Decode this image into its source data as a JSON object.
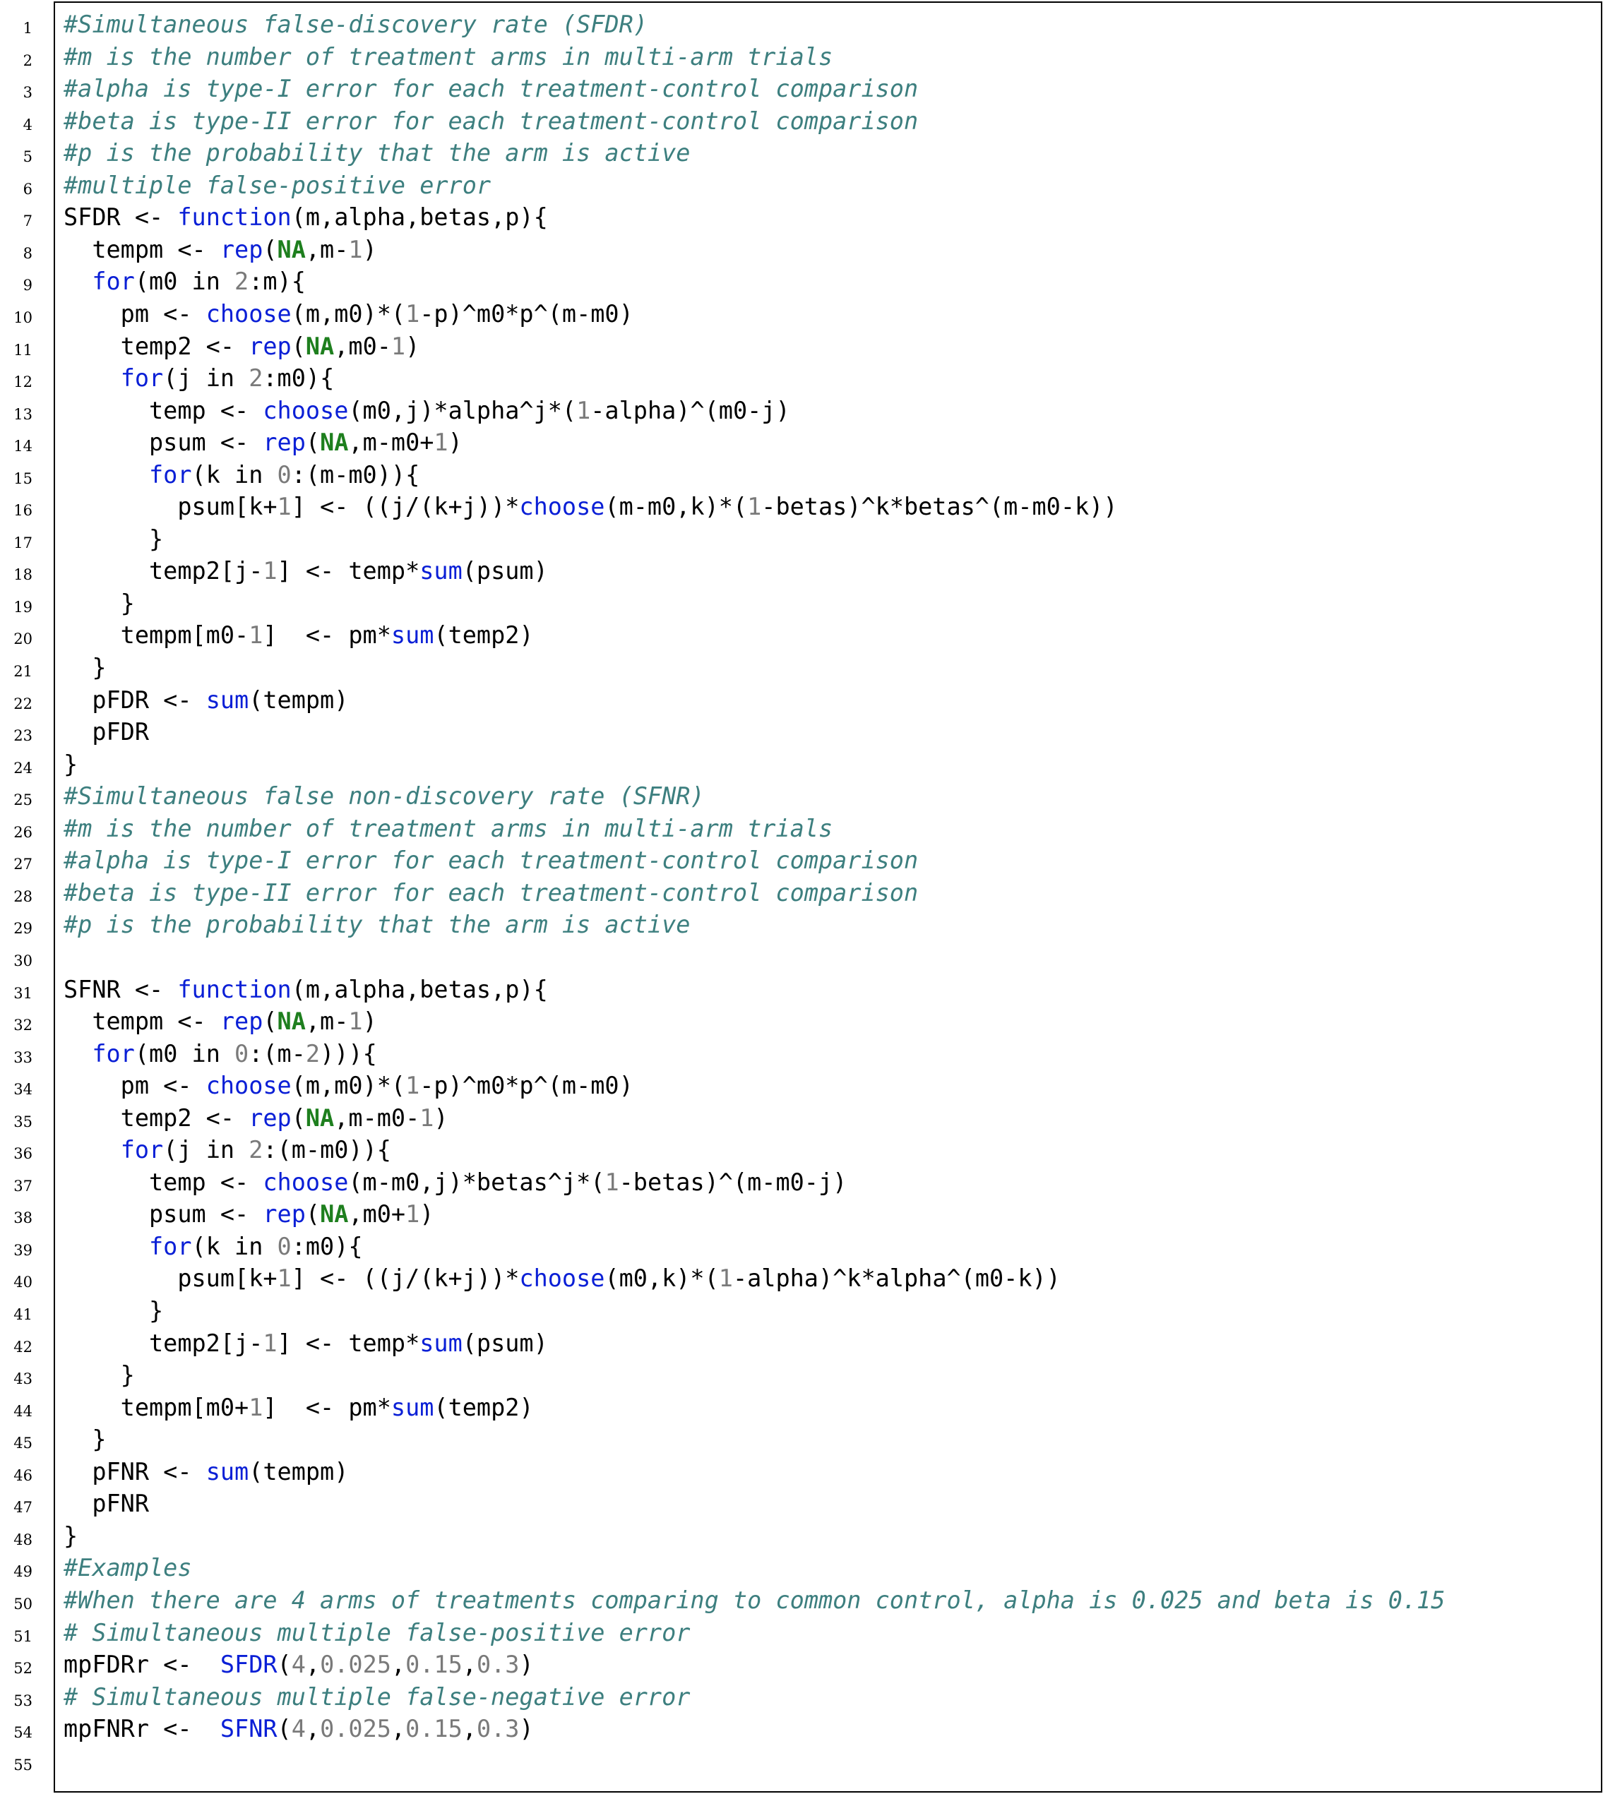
{
  "listing": {
    "lines": [
      {
        "num": "1",
        "tokens": [
          [
            "c",
            "#Simultaneous false-discovery rate (SFDR)"
          ]
        ]
      },
      {
        "num": "2",
        "tokens": [
          [
            "c",
            "#m is the number of treatment arms in multi-arm trials"
          ]
        ]
      },
      {
        "num": "3",
        "tokens": [
          [
            "c",
            "#alpha is type-I error for each treatment-control comparison"
          ]
        ]
      },
      {
        "num": "4",
        "tokens": [
          [
            "c",
            "#beta is type-II error for each treatment-control comparison"
          ]
        ]
      },
      {
        "num": "5",
        "tokens": [
          [
            "c",
            "#p is the probability that the arm is active"
          ]
        ]
      },
      {
        "num": "6",
        "tokens": [
          [
            "c",
            "#multiple false-positive error"
          ]
        ]
      },
      {
        "num": "7",
        "tokens": [
          [
            "t",
            "SFDR <- "
          ],
          [
            "k",
            "function"
          ],
          [
            "t",
            "(m,alpha,betas,p){"
          ]
        ]
      },
      {
        "num": "8",
        "tokens": [
          [
            "t",
            "  tempm <- "
          ],
          [
            "k",
            "rep"
          ],
          [
            "t",
            "("
          ],
          [
            "g",
            "NA"
          ],
          [
            "t",
            ",m-"
          ],
          [
            "n",
            "1"
          ],
          [
            "t",
            ")"
          ]
        ]
      },
      {
        "num": "9",
        "tokens": [
          [
            "t",
            "  "
          ],
          [
            "k",
            "for"
          ],
          [
            "t",
            "(m0 in "
          ],
          [
            "n",
            "2"
          ],
          [
            "t",
            ":m){"
          ]
        ]
      },
      {
        "num": "10",
        "tokens": [
          [
            "t",
            "    pm <- "
          ],
          [
            "k",
            "choose"
          ],
          [
            "t",
            "(m,m0)*("
          ],
          [
            "n",
            "1"
          ],
          [
            "t",
            "-p)^m0*p^(m-m0)"
          ]
        ]
      },
      {
        "num": "11",
        "tokens": [
          [
            "t",
            "    temp2 <- "
          ],
          [
            "k",
            "rep"
          ],
          [
            "t",
            "("
          ],
          [
            "g",
            "NA"
          ],
          [
            "t",
            ",m0-"
          ],
          [
            "n",
            "1"
          ],
          [
            "t",
            ")"
          ]
        ]
      },
      {
        "num": "12",
        "tokens": [
          [
            "t",
            "    "
          ],
          [
            "k",
            "for"
          ],
          [
            "t",
            "(j in "
          ],
          [
            "n",
            "2"
          ],
          [
            "t",
            ":m0){"
          ]
        ]
      },
      {
        "num": "13",
        "tokens": [
          [
            "t",
            "      temp <- "
          ],
          [
            "k",
            "choose"
          ],
          [
            "t",
            "(m0,j)*alpha^j*("
          ],
          [
            "n",
            "1"
          ],
          [
            "t",
            "-alpha)^(m0-j)"
          ]
        ]
      },
      {
        "num": "14",
        "tokens": [
          [
            "t",
            "      psum <- "
          ],
          [
            "k",
            "rep"
          ],
          [
            "t",
            "("
          ],
          [
            "g",
            "NA"
          ],
          [
            "t",
            ",m-m0+"
          ],
          [
            "n",
            "1"
          ],
          [
            "t",
            ")"
          ]
        ]
      },
      {
        "num": "15",
        "tokens": [
          [
            "t",
            "      "
          ],
          [
            "k",
            "for"
          ],
          [
            "t",
            "(k in "
          ],
          [
            "n",
            "0"
          ],
          [
            "t",
            ":(m-m0)){"
          ]
        ]
      },
      {
        "num": "16",
        "tokens": [
          [
            "t",
            "        psum[k+"
          ],
          [
            "n",
            "1"
          ],
          [
            "t",
            "] <- ((j/(k+j))*"
          ],
          [
            "k",
            "choose"
          ],
          [
            "t",
            "(m-m0,k)*("
          ],
          [
            "n",
            "1"
          ],
          [
            "t",
            "-betas)^k*betas^(m-m0-k))"
          ]
        ]
      },
      {
        "num": "17",
        "tokens": [
          [
            "t",
            "      }"
          ]
        ]
      },
      {
        "num": "18",
        "tokens": [
          [
            "t",
            "      temp2[j-"
          ],
          [
            "n",
            "1"
          ],
          [
            "t",
            "] <- temp*"
          ],
          [
            "k",
            "sum"
          ],
          [
            "t",
            "(psum)"
          ]
        ]
      },
      {
        "num": "19",
        "tokens": [
          [
            "t",
            "    }"
          ]
        ]
      },
      {
        "num": "20",
        "tokens": [
          [
            "t",
            "    tempm[m0-"
          ],
          [
            "n",
            "1"
          ],
          [
            "t",
            "]  <- pm*"
          ],
          [
            "k",
            "sum"
          ],
          [
            "t",
            "(temp2)"
          ]
        ]
      },
      {
        "num": "21",
        "tokens": [
          [
            "t",
            "  }"
          ]
        ]
      },
      {
        "num": "22",
        "tokens": [
          [
            "t",
            "  pFDR <- "
          ],
          [
            "k",
            "sum"
          ],
          [
            "t",
            "(tempm)"
          ]
        ]
      },
      {
        "num": "23",
        "tokens": [
          [
            "t",
            "  pFDR"
          ]
        ]
      },
      {
        "num": "24",
        "tokens": [
          [
            "t",
            "}"
          ]
        ]
      },
      {
        "num": "25",
        "tokens": [
          [
            "c",
            "#Simultaneous false non-discovery rate (SFNR)"
          ]
        ]
      },
      {
        "num": "26",
        "tokens": [
          [
            "c",
            "#m is the number of treatment arms in multi-arm trials"
          ]
        ]
      },
      {
        "num": "27",
        "tokens": [
          [
            "c",
            "#alpha is type-I error for each treatment-control comparison"
          ]
        ]
      },
      {
        "num": "28",
        "tokens": [
          [
            "c",
            "#beta is type-II error for each treatment-control comparison"
          ]
        ]
      },
      {
        "num": "29",
        "tokens": [
          [
            "c",
            "#p is the probability that the arm is active"
          ]
        ]
      },
      {
        "num": "30",
        "tokens": []
      },
      {
        "num": "31",
        "tokens": [
          [
            "t",
            "SFNR <- "
          ],
          [
            "k",
            "function"
          ],
          [
            "t",
            "(m,alpha,betas,p){"
          ]
        ]
      },
      {
        "num": "32",
        "tokens": [
          [
            "t",
            "  tempm <- "
          ],
          [
            "k",
            "rep"
          ],
          [
            "t",
            "("
          ],
          [
            "g",
            "NA"
          ],
          [
            "t",
            ",m-"
          ],
          [
            "n",
            "1"
          ],
          [
            "t",
            ")"
          ]
        ]
      },
      {
        "num": "33",
        "tokens": [
          [
            "t",
            "  "
          ],
          [
            "k",
            "for"
          ],
          [
            "t",
            "(m0 in "
          ],
          [
            "n",
            "0"
          ],
          [
            "t",
            ":(m-"
          ],
          [
            "n",
            "2"
          ],
          [
            "t",
            "))){"
          ]
        ]
      },
      {
        "num": "34",
        "tokens": [
          [
            "t",
            "    pm <- "
          ],
          [
            "k",
            "choose"
          ],
          [
            "t",
            "(m,m0)*("
          ],
          [
            "n",
            "1"
          ],
          [
            "t",
            "-p)^m0*p^(m-m0)"
          ]
        ]
      },
      {
        "num": "35",
        "tokens": [
          [
            "t",
            "    temp2 <- "
          ],
          [
            "k",
            "rep"
          ],
          [
            "t",
            "("
          ],
          [
            "g",
            "NA"
          ],
          [
            "t",
            ",m-m0-"
          ],
          [
            "n",
            "1"
          ],
          [
            "t",
            ")"
          ]
        ]
      },
      {
        "num": "36",
        "tokens": [
          [
            "t",
            "    "
          ],
          [
            "k",
            "for"
          ],
          [
            "t",
            "(j in "
          ],
          [
            "n",
            "2"
          ],
          [
            "t",
            ":(m-m0)){"
          ]
        ]
      },
      {
        "num": "37",
        "tokens": [
          [
            "t",
            "      temp <- "
          ],
          [
            "k",
            "choose"
          ],
          [
            "t",
            "(m-m0,j)*betas^j*("
          ],
          [
            "n",
            "1"
          ],
          [
            "t",
            "-betas)^(m-m0-j)"
          ]
        ]
      },
      {
        "num": "38",
        "tokens": [
          [
            "t",
            "      psum <- "
          ],
          [
            "k",
            "rep"
          ],
          [
            "t",
            "("
          ],
          [
            "g",
            "NA"
          ],
          [
            "t",
            ",m0+"
          ],
          [
            "n",
            "1"
          ],
          [
            "t",
            ")"
          ]
        ]
      },
      {
        "num": "39",
        "tokens": [
          [
            "t",
            "      "
          ],
          [
            "k",
            "for"
          ],
          [
            "t",
            "(k in "
          ],
          [
            "n",
            "0"
          ],
          [
            "t",
            ":m0){"
          ]
        ]
      },
      {
        "num": "40",
        "tokens": [
          [
            "t",
            "        psum[k+"
          ],
          [
            "n",
            "1"
          ],
          [
            "t",
            "] <- ((j/(k+j))*"
          ],
          [
            "k",
            "choose"
          ],
          [
            "t",
            "(m0,k)*("
          ],
          [
            "n",
            "1"
          ],
          [
            "t",
            "-alpha)^k*alpha^(m0-k))"
          ]
        ]
      },
      {
        "num": "41",
        "tokens": [
          [
            "t",
            "      }"
          ]
        ]
      },
      {
        "num": "42",
        "tokens": [
          [
            "t",
            "      temp2[j-"
          ],
          [
            "n",
            "1"
          ],
          [
            "t",
            "] <- temp*"
          ],
          [
            "k",
            "sum"
          ],
          [
            "t",
            "(psum)"
          ]
        ]
      },
      {
        "num": "43",
        "tokens": [
          [
            "t",
            "    }"
          ]
        ]
      },
      {
        "num": "44",
        "tokens": [
          [
            "t",
            "    tempm[m0+"
          ],
          [
            "n",
            "1"
          ],
          [
            "t",
            "]  <- pm*"
          ],
          [
            "k",
            "sum"
          ],
          [
            "t",
            "(temp2)"
          ]
        ]
      },
      {
        "num": "45",
        "tokens": [
          [
            "t",
            "  }"
          ]
        ]
      },
      {
        "num": "46",
        "tokens": [
          [
            "t",
            "  pFNR <- "
          ],
          [
            "k",
            "sum"
          ],
          [
            "t",
            "(tempm)"
          ]
        ]
      },
      {
        "num": "47",
        "tokens": [
          [
            "t",
            "  pFNR"
          ]
        ]
      },
      {
        "num": "48",
        "tokens": [
          [
            "t",
            "}"
          ]
        ]
      },
      {
        "num": "49",
        "tokens": [
          [
            "c",
            "#Examples"
          ]
        ]
      },
      {
        "num": "50",
        "tokens": [
          [
            "c",
            "#When there are 4 arms of treatments comparing to common control, alpha is 0.025 and beta is 0.15"
          ]
        ]
      },
      {
        "num": "51",
        "tokens": [
          [
            "c",
            "# Simultaneous multiple false-positive error"
          ]
        ]
      },
      {
        "num": "52",
        "tokens": [
          [
            "t",
            "mpFDRr <-  "
          ],
          [
            "k",
            "SFDR"
          ],
          [
            "t",
            "("
          ],
          [
            "n",
            "4"
          ],
          [
            "t",
            ","
          ],
          [
            "n",
            "0.025"
          ],
          [
            "t",
            ","
          ],
          [
            "n",
            "0.15"
          ],
          [
            "t",
            ","
          ],
          [
            "n",
            "0.3"
          ],
          [
            "t",
            ")"
          ]
        ]
      },
      {
        "num": "53",
        "tokens": [
          [
            "c",
            "# Simultaneous multiple false-negative error"
          ]
        ]
      },
      {
        "num": "54",
        "tokens": [
          [
            "t",
            "mpFNRr <-  "
          ],
          [
            "k",
            "SFNR"
          ],
          [
            "t",
            "("
          ],
          [
            "n",
            "4"
          ],
          [
            "t",
            ","
          ],
          [
            "n",
            "0.025"
          ],
          [
            "t",
            ","
          ],
          [
            "n",
            "0.15"
          ],
          [
            "t",
            ","
          ],
          [
            "n",
            "0.3"
          ],
          [
            "t",
            ")"
          ]
        ]
      },
      {
        "num": "55",
        "tokens": []
      }
    ]
  },
  "colors": {
    "comment": "#3d7f7f",
    "keyword": "#0a1fd6",
    "constant": "#1e7f1e",
    "number": "#7a7a7a",
    "text": "#000000"
  }
}
